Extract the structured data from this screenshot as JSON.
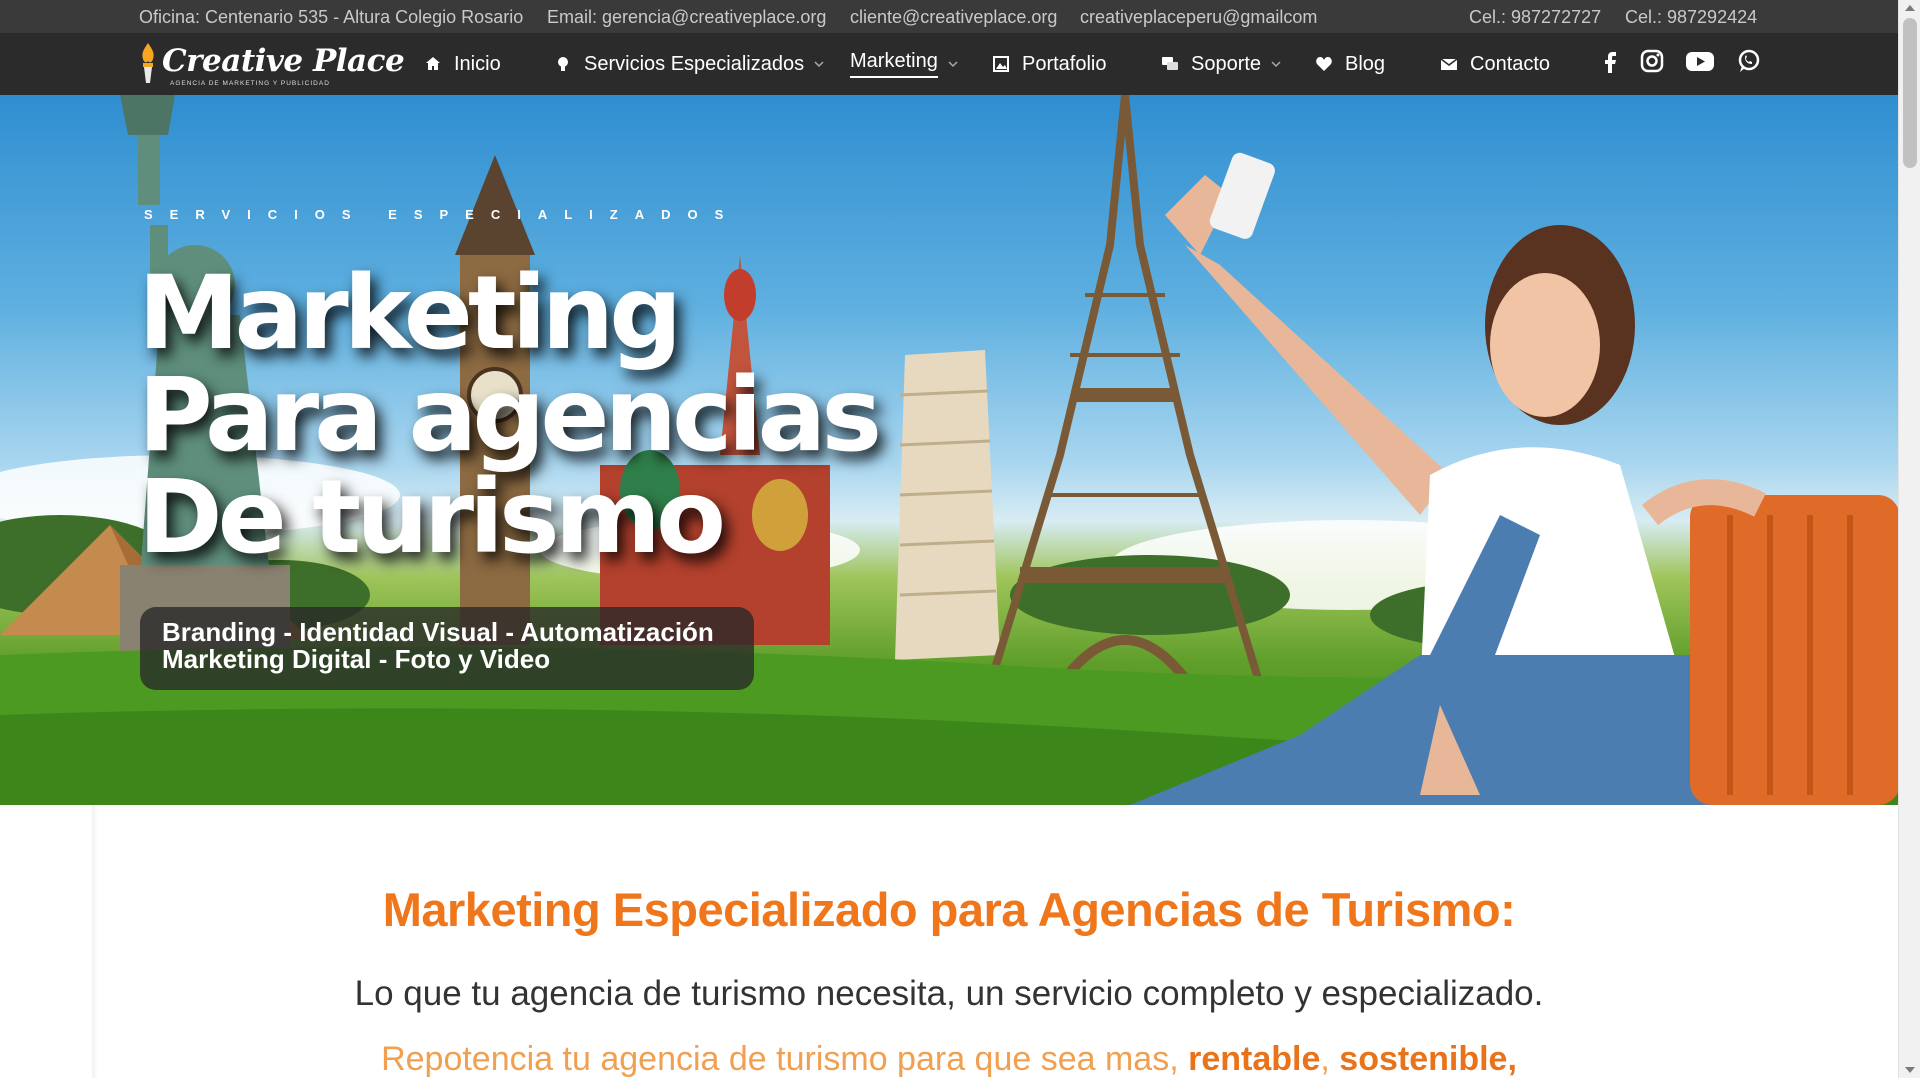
{
  "topbar": {
    "office": "Oficina: Centenario 535 - Altura Colegio Rosario",
    "email_gerencia": "Email: gerencia@creativeplace.org",
    "email_cliente": "cliente@creativeplace.org",
    "email_gmail": "creativeplaceperu@gmailcom",
    "phone1": "Cel.: 987272727",
    "phone2": "Cel.: 987292424"
  },
  "logo": {
    "name": "Creative Place",
    "tagline": "AGENCIA DE MARKETING Y PUBLICIDAD"
  },
  "nav": {
    "items": [
      {
        "label": "Inicio",
        "icon": "home-icon"
      },
      {
        "label": "Servicios Especializados",
        "icon": "lightbulb-icon",
        "has_dropdown": true
      },
      {
        "label": "Marketing",
        "has_dropdown": true,
        "active": true
      },
      {
        "label": "Portafolio",
        "icon": "image-icon"
      },
      {
        "label": "Soporte",
        "icon": "chat-icon",
        "has_dropdown": true
      },
      {
        "label": "Blog",
        "icon": "heart-icon"
      },
      {
        "label": "Contacto",
        "icon": "mail-icon"
      }
    ],
    "social": [
      "facebook-icon",
      "instagram-icon",
      "youtube-icon",
      "whatsapp-icon"
    ]
  },
  "hero": {
    "eyebrow": "SERVICIOS ESPECIALIZADOS",
    "title_line1": "Marketing",
    "title_line2": "Para agencias",
    "title_line3": "De turismo",
    "pill_line1": "Branding - Identidad Visual - Automatización",
    "pill_line2": "Marketing Digital - Foto y Video"
  },
  "content": {
    "heading": "Marketing Especializado para Agencias de Turismo:",
    "lead": "Lo que tu agencia de turismo necesita, un servicio completo y especializado.",
    "sub_prefix": "Repotencia tu agencia de turismo para que sea mas, ",
    "sub_bold1": "rentable",
    "sub_sep": ", ",
    "sub_bold2": "sostenible,"
  },
  "colors": {
    "accent": "#f0761c",
    "nav_bg": "#2b2b2b",
    "topbar_bg": "#3a3a3a"
  }
}
